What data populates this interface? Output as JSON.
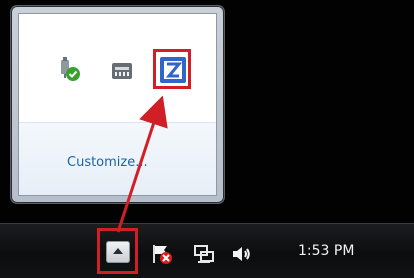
{
  "popup": {
    "customize_label": "Customize..."
  },
  "taskbar": {
    "clock": "1:53 PM"
  },
  "icons": {
    "popup": [
      "usb-safely-remove-icon",
      "memory-card-icon",
      "z-app-icon"
    ],
    "taskbar": [
      "show-hidden-icons-arrow-icon",
      "action-center-flag-icon",
      "network-icon",
      "volume-icon"
    ]
  },
  "colors": {
    "highlight": "#d01f26",
    "accent_link": "#1e63a6",
    "taskbar_background": "#0c0d0e",
    "z_icon_blue": "#2f66c7"
  }
}
